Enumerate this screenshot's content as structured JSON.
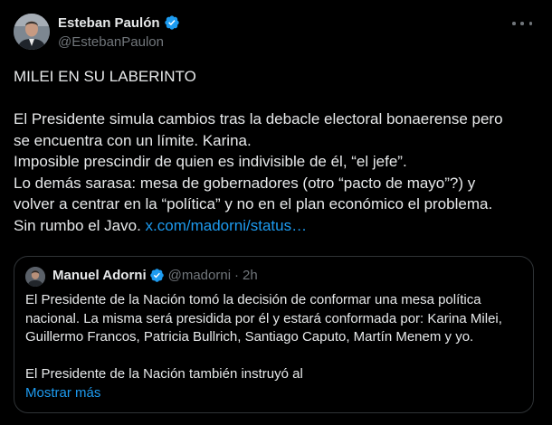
{
  "author": {
    "display_name": "Esteban Paulón",
    "handle": "@EstebanPaulon"
  },
  "tweet": {
    "title_line": "MILEI EN SU LABERINTO",
    "lines": [
      "El Presidente simula cambios tras la debacle electoral bonaerense pero",
      "se encuentra con un límite. Karina.",
      "Imposible prescindir de quien es indivisible de él, “el jefe”.",
      "Lo demás sarasa: mesa de gobernadores (otro “pacto de mayo”?) y",
      "volver a centrar en la “política” y no en el plan económico el problema."
    ],
    "last_line_text": "Sin rumbo el Javo.",
    "link_text": "x.com/madorni/status…"
  },
  "quoted": {
    "display_name": "Manuel Adorni",
    "handle": "@madorni",
    "separator": "·",
    "time": "2h",
    "lines": [
      "El Presidente de la Nación tomó la decisión de conformar una mesa política",
      "nacional. La misma será presidida por él y estará conformada por: Karina Milei,",
      "Guillermo Francos, Patricia Bullrich, Santiago Caputo, Martín Menem y yo."
    ],
    "truncated_line": "El Presidente de la Nación también instruyó al",
    "show_more": "Mostrar más"
  },
  "colors": {
    "background": "#000000",
    "text": "#e7e9ea",
    "muted": "#71767b",
    "link": "#1d9bf0",
    "verified_badge": "#1d9bf0",
    "border": "#2f3336"
  },
  "icons": {
    "verified": "verified-badge-icon",
    "more": "more-options-icon"
  }
}
